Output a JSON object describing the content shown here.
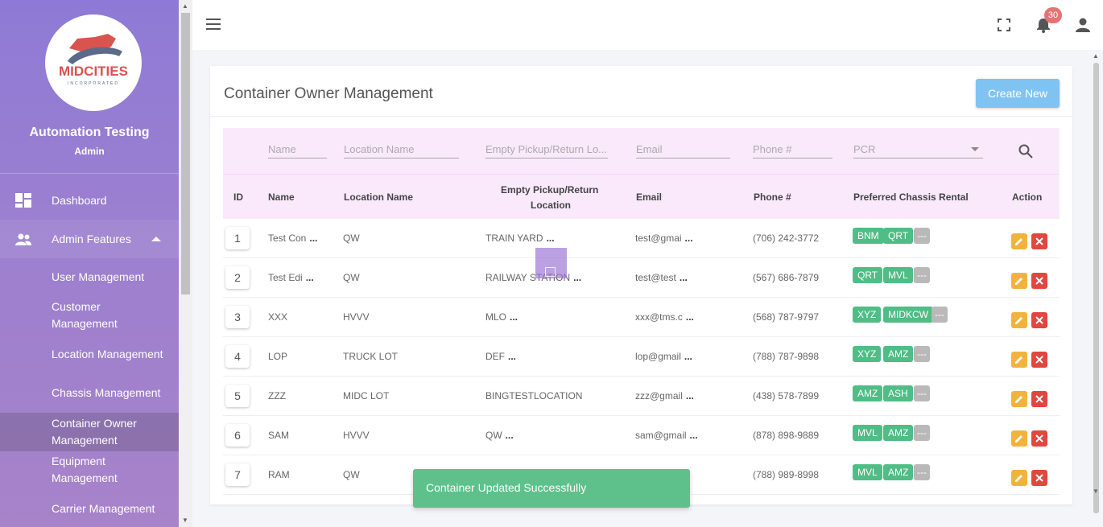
{
  "sidebar": {
    "logo_text": "MIDCITIES",
    "logo_sub": "INCORPORATED",
    "user_name": "Automation Testing",
    "user_role": "Admin",
    "nav": {
      "dashboard": "Dashboard",
      "admin_features": "Admin Features"
    },
    "sub_items": [
      "User Management",
      "Customer Management",
      "Location Management",
      "Chassis Management",
      "Container Owner Management",
      "Equipment Management",
      "Carrier Management"
    ],
    "active_item": "Container Owner Management"
  },
  "topbar": {
    "notification_count": "30"
  },
  "page": {
    "title": "Container Owner Management",
    "create_button": "Create New"
  },
  "filters": {
    "name": "Name",
    "location": "Location Name",
    "empty": "Empty Pickup/Return Lo...",
    "email": "Email",
    "phone": "Phone #",
    "pcr": "PCR"
  },
  "headers": {
    "id": "ID",
    "name": "Name",
    "location": "Location Name",
    "empty_1": "Empty Pickup/Return",
    "empty_2": "Location",
    "email": "Email",
    "phone": "Phone #",
    "pcr": "Preferred Chassis Rental",
    "action": "Action"
  },
  "rows": [
    {
      "id": "1",
      "name": "Test Con",
      "name_more": true,
      "location": "QW",
      "empty": "TRAIN YARD",
      "empty_more": true,
      "email": "test@gmai",
      "phone": "(706) 242-3772",
      "tags": [
        "BNM",
        "QRT"
      ]
    },
    {
      "id": "2",
      "name": "Test Edi",
      "name_more": true,
      "location": "QW",
      "empty": "RAILWAY STATION",
      "empty_more": true,
      "email": "test@test",
      "phone": "(567) 686-7879",
      "tags": [
        "QRT",
        "MVL"
      ]
    },
    {
      "id": "3",
      "name": "XXX",
      "name_more": false,
      "location": "HVVV",
      "empty": "MLO",
      "empty_more": true,
      "email": "xxx@tms.c",
      "phone": "(568) 787-9797",
      "tags": [
        "XYZ",
        "MIDKCW"
      ]
    },
    {
      "id": "4",
      "name": "LOP",
      "name_more": false,
      "location": "TRUCK LOT",
      "empty": "DEF",
      "empty_more": true,
      "email": "lop@gmail",
      "phone": "(788) 787-9898",
      "tags": [
        "XYZ",
        "AMZ"
      ]
    },
    {
      "id": "5",
      "name": "ZZZ",
      "name_more": false,
      "location": "MIDC LOT",
      "empty": "BINGTESTLOCATION",
      "empty_more": false,
      "email": "zzz@gmail",
      "phone": "(438) 578-7899",
      "tags": [
        "AMZ",
        "ASH"
      ]
    },
    {
      "id": "6",
      "name": "SAM",
      "name_more": false,
      "location": "HVVV",
      "empty": "QW",
      "empty_more": true,
      "email": "sam@gmail",
      "phone": "(878) 898-9889",
      "tags": [
        "MVL",
        "AMZ"
      ]
    },
    {
      "id": "7",
      "name": "RAM",
      "name_more": false,
      "location": "QW",
      "empty": "",
      "empty_more": false,
      "email": "",
      "phone": "(788) 989-8998",
      "tags": [
        "MVL",
        "AMZ"
      ]
    }
  ],
  "more_label": "...",
  "tag_more_label": "---",
  "toast": {
    "message": "Container Updated Successfully"
  },
  "colors": {
    "sidebar": "#8e7ad6",
    "accent_green": "#4fbd85",
    "create_button": "#7fc3f3",
    "edit": "#f2b33d",
    "delete": "#e2473f",
    "filter_bg": "#f9e9fb"
  }
}
